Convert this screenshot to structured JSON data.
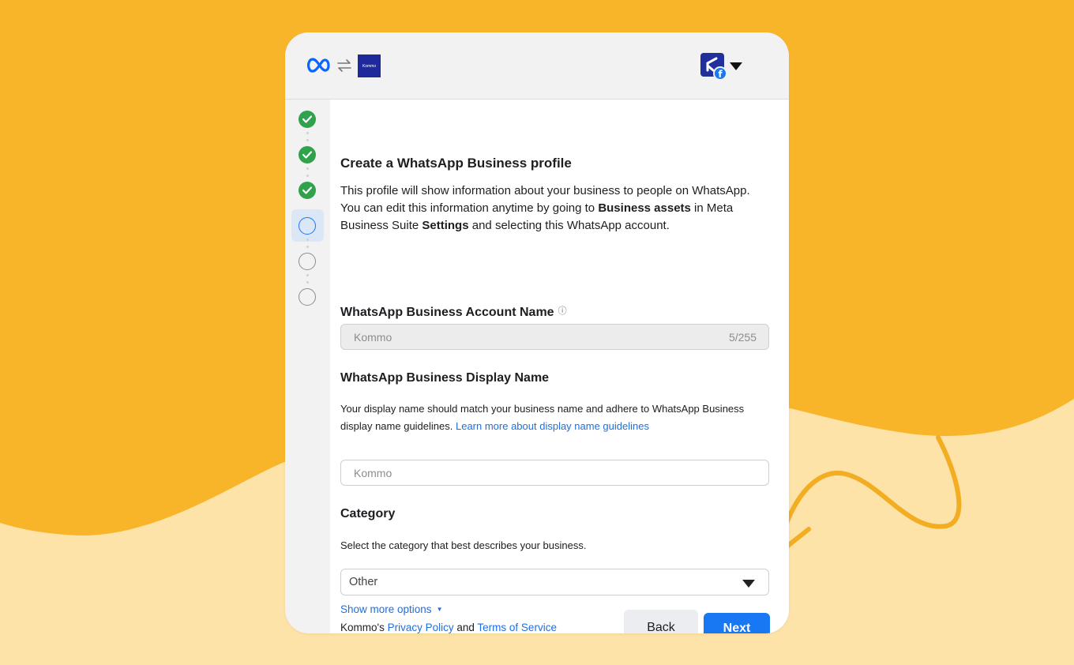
{
  "header": {
    "partner_logo_text": "Kommo",
    "brand_colors": {
      "meta_blue": "#0866ff",
      "kommo_navy": "#1e2a9c",
      "facebook_blue": "#1877f2"
    }
  },
  "stepper": {
    "steps": [
      {
        "status": "complete"
      },
      {
        "status": "complete"
      },
      {
        "status": "complete"
      },
      {
        "status": "current"
      },
      {
        "status": "pending"
      },
      {
        "status": "pending"
      }
    ]
  },
  "form": {
    "title": "Create a WhatsApp Business profile",
    "description": {
      "part1": "This profile will show information about your business to people on WhatsApp. You can edit this information anytime by going to ",
      "bold1": "Business assets",
      "part2": " in Meta Business Suite ",
      "bold2": "Settings",
      "part3": " and selecting this WhatsApp account."
    },
    "account_name": {
      "label": "WhatsApp Business Account Name",
      "info_icon": "ⓘ",
      "value": "Kommo",
      "char_count": "5/255"
    },
    "display_name": {
      "label": "WhatsApp Business Display Name",
      "help": "Your display name should match your business name and adhere to WhatsApp Business display name guidelines. ",
      "help_link": "Learn more about display name guidelines",
      "value": "Kommo"
    },
    "category": {
      "label": "Category",
      "help": "Select the category that best describes your business.",
      "selected": "Other"
    },
    "show_more_options": "Show more options",
    "legal": {
      "prefix": "Kommo's ",
      "privacy_link": "Privacy Policy",
      "and": " and ",
      "terms_link": "Terms of Service"
    },
    "back_label": "Back",
    "next_label": "Next"
  }
}
